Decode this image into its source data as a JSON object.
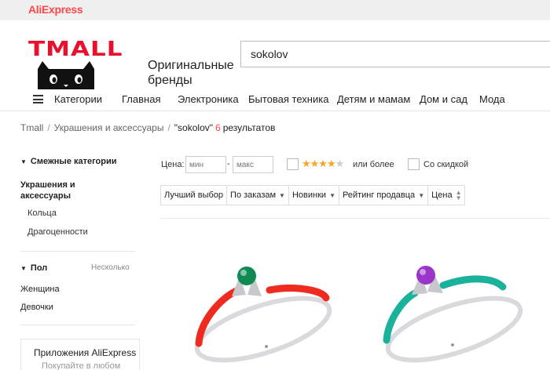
{
  "topbar": {
    "logo_text": "AliExpress",
    "brand_color": "#ff4747"
  },
  "header": {
    "tmall_logo_text": "TMALL",
    "brands_line1": "Оригинальные",
    "brands_line2": "бренды",
    "search_value": "sokolov"
  },
  "nav": {
    "menu_icon": "hamburger-icon",
    "categories_label": "Категории",
    "items": [
      "Главная",
      "Электроника",
      "Бытовая техника",
      "Детям и мамам",
      "Дом и сад",
      "Мода"
    ]
  },
  "breadcrumb": {
    "items": [
      "Tmall",
      "Украшения и аксессуары"
    ],
    "query": "\"sokolov\"",
    "count": "6",
    "results_word": "результатов"
  },
  "sidebar": {
    "related_title": "Смежные категории",
    "category_line1": "Украшения и",
    "category_line2": "аксессуары",
    "subcategories": [
      "Кольца",
      "Драгоценности"
    ],
    "gender_title": "Пол",
    "gender_multi": "Несколько",
    "gender_options": [
      "Женщина",
      "Девочки"
    ],
    "app_title": "Приложения AliExpress",
    "app_sub": "Покупайте в любом"
  },
  "filters": {
    "price_label": "Цена:",
    "price_min_placeholder": "мин",
    "price_max_placeholder": "макс",
    "rating_stars_filled": 4,
    "rating_stars_total": 5,
    "rating_label": "или более",
    "discount_label": "Со скидкой"
  },
  "sort": {
    "best": "Лучший выбор",
    "orders": "По заказам",
    "new": "Новинки",
    "seller_rating": "Рейтинг продавца",
    "price": "Цена"
  },
  "products": [
    {
      "band_color": "#ef2a1f",
      "stone_color": "#0f8a52",
      "metal_color": "#d9d9de"
    },
    {
      "band_color": "#1bb29c",
      "stone_color": "#9b34c8",
      "metal_color": "#d9d9de"
    }
  ]
}
